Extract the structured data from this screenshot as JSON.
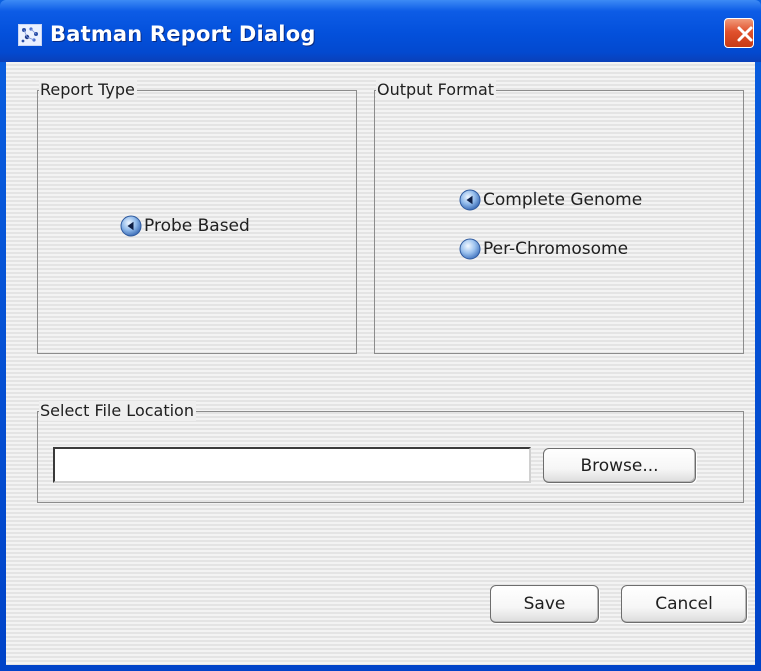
{
  "window": {
    "title": "Batman Report Dialog"
  },
  "report_type": {
    "label": "Report Type",
    "options": [
      {
        "label": "Probe Based",
        "selected": true
      }
    ]
  },
  "output_format": {
    "label": "Output Format",
    "options": [
      {
        "label": "Complete Genome",
        "selected": true
      },
      {
        "label": "Per-Chromosome",
        "selected": false
      }
    ]
  },
  "file_location": {
    "label": "Select File Location",
    "path_value": "",
    "browse_label": "Browse..."
  },
  "actions": {
    "save_label": "Save",
    "cancel_label": "Cancel"
  },
  "colors": {
    "titlebar": "#0350db",
    "close_button": "#e0512d",
    "panel_background": "#efefef",
    "group_border": "#8c8c8c"
  }
}
